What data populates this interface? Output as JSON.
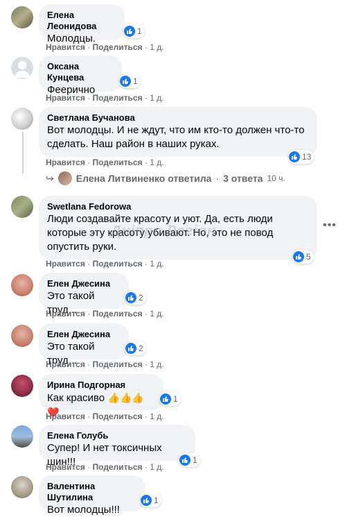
{
  "labels": {
    "like": "Нравится",
    "share": "Поделиться",
    "dot": "·"
  },
  "comments": [
    {
      "author": "Елена Леонидова",
      "text": "Молодцы.",
      "time": "1 д.",
      "likes": "1"
    },
    {
      "author": "Оксана Кунцева",
      "text": "Феерично",
      "time": "1 д.",
      "likes": "1"
    },
    {
      "author": "Светлана Бучанова",
      "text_line1": "Вот молодцы. И не ждут, что им кто-то должен что-то",
      "text_line2": "сделать. Наш район в наших руках.",
      "time": "1 д.",
      "likes": "13"
    },
    {
      "author": "Swetlana Fedorowa",
      "text_line1": "Люди создавайте красоту и уют. Да, есть люди",
      "text_line2": "которые эту красоту убивают. Но, это не повод",
      "text_line3": "опустить руки.",
      "time": "1 д.",
      "likes": "5"
    },
    {
      "author": "Елен Джесина",
      "text": "Это такой труд...",
      "time": "1 д.",
      "likes": "2"
    },
    {
      "author": "Елен Джесина",
      "text": "Это такой труд...",
      "time": "1 д.",
      "likes": "2"
    },
    {
      "author": "Ирина Подгорная",
      "text": "Как красиво",
      "emoji": "👍👍👍❤️",
      "time": "1 д.",
      "likes": "1"
    },
    {
      "author": "Елена Голубь",
      "text": "Супер! И нет токсичных шин!!!",
      "time": "1 д.",
      "likes": "1"
    },
    {
      "author": "Валентина Шутилина",
      "text": "Вот молодцы!!!",
      "likes": "1"
    }
  ],
  "reply": {
    "author_text": "Елена Литвиненко ответила",
    "count_text": "3 ответа",
    "time": "10 ч."
  },
  "watermark": "Дніпро Регіон",
  "colors": {
    "bubble": "#f0f2f5",
    "like_blue": "#1877f2",
    "meta": "#65676b"
  }
}
